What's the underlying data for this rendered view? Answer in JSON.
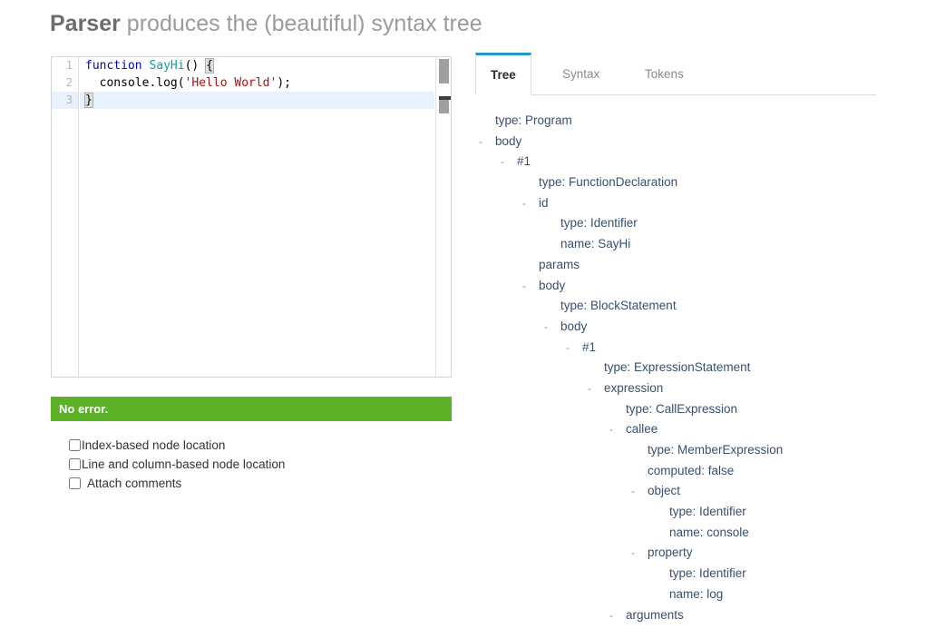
{
  "heading": {
    "strong": "Parser",
    "rest": " produces the (beautiful) syntax tree"
  },
  "editor": {
    "line_numbers": [
      "1",
      "2",
      "3"
    ],
    "lines": [
      {
        "number": "1",
        "active": false,
        "tokens": [
          {
            "text": "function",
            "cls": "tok-kw"
          },
          {
            "text": " ",
            "cls": "tok-punct"
          },
          {
            "text": "SayHi",
            "cls": "tok-fn"
          },
          {
            "text": "() ",
            "cls": "tok-punct"
          },
          {
            "text": "{",
            "cls": "tok-brace-m"
          }
        ]
      },
      {
        "number": "2",
        "active": false,
        "tokens": [
          {
            "text": "  console.log(",
            "cls": "tok-punct"
          },
          {
            "text": "'Hello World'",
            "cls": "tok-str"
          },
          {
            "text": ");",
            "cls": "tok-punct"
          }
        ]
      },
      {
        "number": "3",
        "active": true,
        "tokens": [
          {
            "text": "}",
            "cls": "tok-brace-m"
          }
        ]
      }
    ],
    "plain_text": "function SayHi() {\n  console.log('Hello World');\n}"
  },
  "status": {
    "message": "No error.",
    "color": "#5cb226"
  },
  "options": [
    {
      "label": "Index-based node location",
      "checked": false,
      "gap": false
    },
    {
      "label": "Line and column-based node location",
      "checked": false,
      "gap": false
    },
    {
      "label": "Attach comments",
      "checked": false,
      "gap": true
    }
  ],
  "tabs": [
    {
      "label": "Tree",
      "active": true
    },
    {
      "label": "Syntax",
      "active": false
    },
    {
      "label": "Tokens",
      "active": false
    }
  ],
  "accent_color": "#2599c4",
  "tree": {
    "rows": [
      {
        "label": "type: Program",
        "depth": 1,
        "toggle": ""
      },
      {
        "label": "body",
        "depth": 1,
        "toggle": "-"
      },
      {
        "label": "#1",
        "depth": 2,
        "toggle": "-"
      },
      {
        "label": "type: FunctionDeclaration",
        "depth": 3,
        "toggle": ""
      },
      {
        "label": "id",
        "depth": 3,
        "toggle": "-"
      },
      {
        "label": "type: Identifier",
        "depth": 4,
        "toggle": ""
      },
      {
        "label": "name: SayHi",
        "depth": 4,
        "toggle": ""
      },
      {
        "label": "params",
        "depth": 3,
        "toggle": ""
      },
      {
        "label": "body",
        "depth": 3,
        "toggle": "-"
      },
      {
        "label": "type: BlockStatement",
        "depth": 4,
        "toggle": ""
      },
      {
        "label": "body",
        "depth": 4,
        "toggle": "-"
      },
      {
        "label": "#1",
        "depth": 5,
        "toggle": "-"
      },
      {
        "label": "type: ExpressionStatement",
        "depth": 6,
        "toggle": ""
      },
      {
        "label": "expression",
        "depth": 6,
        "toggle": "-"
      },
      {
        "label": "type: CallExpression",
        "depth": 7,
        "toggle": ""
      },
      {
        "label": "callee",
        "depth": 7,
        "toggle": "-"
      },
      {
        "label": "type: MemberExpression",
        "depth": 8,
        "toggle": ""
      },
      {
        "label": "computed: false",
        "depth": 8,
        "toggle": ""
      },
      {
        "label": "object",
        "depth": 8,
        "toggle": "-"
      },
      {
        "label": "type: Identifier",
        "depth": 9,
        "toggle": ""
      },
      {
        "label": "name: console",
        "depth": 9,
        "toggle": ""
      },
      {
        "label": "property",
        "depth": 8,
        "toggle": "-"
      },
      {
        "label": "type: Identifier",
        "depth": 9,
        "toggle": ""
      },
      {
        "label": "name: log",
        "depth": 9,
        "toggle": ""
      },
      {
        "label": "arguments",
        "depth": 7,
        "toggle": "-"
      }
    ]
  }
}
